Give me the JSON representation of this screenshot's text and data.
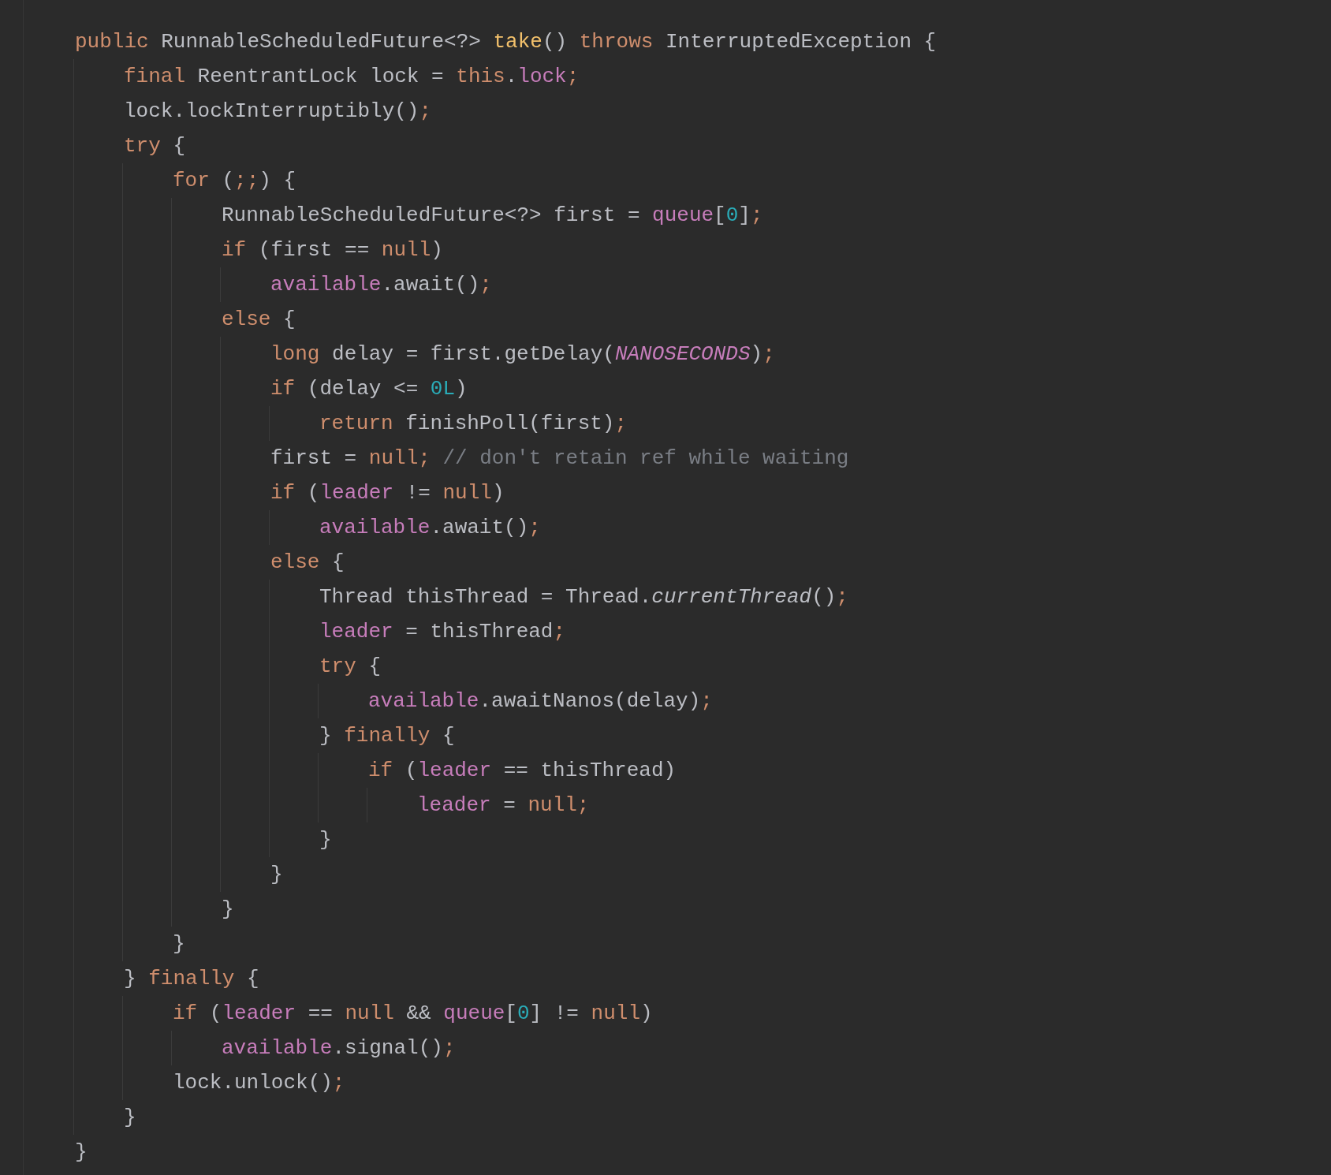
{
  "editor": {
    "lines": [
      {
        "tokens": [
          {
            "kind": "keyword",
            "text": "public"
          },
          {
            "kind": "plain",
            "text": " RunnableScheduledFuture<?> "
          },
          {
            "kind": "declaration",
            "text": "take"
          },
          {
            "kind": "plain",
            "text": "() "
          },
          {
            "kind": "keyword",
            "text": "throws"
          },
          {
            "kind": "plain",
            "text": " InterruptedException {"
          }
        ],
        "children": [
          {
            "tokens": [
              {
                "kind": "keyword",
                "text": "final"
              },
              {
                "kind": "plain",
                "text": " ReentrantLock lock = "
              },
              {
                "kind": "keyword",
                "text": "this"
              },
              {
                "kind": "plain",
                "text": "."
              },
              {
                "kind": "field",
                "text": "lock"
              },
              {
                "kind": "keyword",
                "text": ";"
              }
            ]
          },
          {
            "tokens": [
              {
                "kind": "plain",
                "text": "lock.lockInterruptibly()"
              },
              {
                "kind": "keyword",
                "text": ";"
              }
            ]
          },
          {
            "tokens": [
              {
                "kind": "keyword",
                "text": "try"
              },
              {
                "kind": "plain",
                "text": " {"
              }
            ],
            "children": [
              {
                "tokens": [
                  {
                    "kind": "keyword",
                    "text": "for"
                  },
                  {
                    "kind": "plain",
                    "text": " ("
                  },
                  {
                    "kind": "keyword",
                    "text": ";;"
                  },
                  {
                    "kind": "plain",
                    "text": ") {"
                  }
                ],
                "children": [
                  {
                    "tokens": [
                      {
                        "kind": "plain",
                        "text": "RunnableScheduledFuture<?> first = "
                      },
                      {
                        "kind": "field",
                        "text": "queue"
                      },
                      {
                        "kind": "plain",
                        "text": "["
                      },
                      {
                        "kind": "number",
                        "text": "0"
                      },
                      {
                        "kind": "plain",
                        "text": "]"
                      },
                      {
                        "kind": "keyword",
                        "text": ";"
                      }
                    ]
                  },
                  {
                    "tokens": [
                      {
                        "kind": "keyword",
                        "text": "if"
                      },
                      {
                        "kind": "plain",
                        "text": " (first == "
                      },
                      {
                        "kind": "keyword",
                        "text": "null"
                      },
                      {
                        "kind": "plain",
                        "text": ")"
                      }
                    ],
                    "children": [
                      {
                        "tokens": [
                          {
                            "kind": "field",
                            "text": "available"
                          },
                          {
                            "kind": "plain",
                            "text": ".await()"
                          },
                          {
                            "kind": "keyword",
                            "text": ";"
                          }
                        ]
                      }
                    ]
                  },
                  {
                    "tokens": [
                      {
                        "kind": "keyword",
                        "text": "else"
                      },
                      {
                        "kind": "plain",
                        "text": " {"
                      }
                    ],
                    "children": [
                      {
                        "tokens": [
                          {
                            "kind": "keyword",
                            "text": "long"
                          },
                          {
                            "kind": "plain",
                            "text": " delay = first.getDelay("
                          },
                          {
                            "kind": "static_field",
                            "text": "NANOSECONDS"
                          },
                          {
                            "kind": "plain",
                            "text": ")"
                          },
                          {
                            "kind": "keyword",
                            "text": ";"
                          }
                        ]
                      },
                      {
                        "tokens": [
                          {
                            "kind": "keyword",
                            "text": "if"
                          },
                          {
                            "kind": "plain",
                            "text": " (delay <= "
                          },
                          {
                            "kind": "number",
                            "text": "0L"
                          },
                          {
                            "kind": "plain",
                            "text": ")"
                          }
                        ],
                        "children": [
                          {
                            "tokens": [
                              {
                                "kind": "keyword",
                                "text": "return"
                              },
                              {
                                "kind": "plain",
                                "text": " finishPoll(first)"
                              },
                              {
                                "kind": "keyword",
                                "text": ";"
                              }
                            ]
                          }
                        ]
                      },
                      {
                        "tokens": [
                          {
                            "kind": "plain",
                            "text": "first = "
                          },
                          {
                            "kind": "keyword",
                            "text": "null;"
                          },
                          {
                            "kind": "comment",
                            "text": " // don't retain ref while waiting"
                          }
                        ]
                      },
                      {
                        "tokens": [
                          {
                            "kind": "keyword",
                            "text": "if"
                          },
                          {
                            "kind": "plain",
                            "text": " ("
                          },
                          {
                            "kind": "field",
                            "text": "leader"
                          },
                          {
                            "kind": "plain",
                            "text": " != "
                          },
                          {
                            "kind": "keyword",
                            "text": "null"
                          },
                          {
                            "kind": "plain",
                            "text": ")"
                          }
                        ],
                        "children": [
                          {
                            "tokens": [
                              {
                                "kind": "field",
                                "text": "available"
                              },
                              {
                                "kind": "plain",
                                "text": ".await()"
                              },
                              {
                                "kind": "keyword",
                                "text": ";"
                              }
                            ]
                          }
                        ]
                      },
                      {
                        "tokens": [
                          {
                            "kind": "keyword",
                            "text": "else"
                          },
                          {
                            "kind": "plain",
                            "text": " {"
                          }
                        ],
                        "children": [
                          {
                            "tokens": [
                              {
                                "kind": "plain",
                                "text": "Thread thisThread = Thread."
                              },
                              {
                                "kind": "static_call",
                                "text": "currentThread"
                              },
                              {
                                "kind": "plain",
                                "text": "()"
                              },
                              {
                                "kind": "keyword",
                                "text": ";"
                              }
                            ]
                          },
                          {
                            "tokens": [
                              {
                                "kind": "field",
                                "text": "leader"
                              },
                              {
                                "kind": "plain",
                                "text": " = thisThread"
                              },
                              {
                                "kind": "keyword",
                                "text": ";"
                              }
                            ]
                          },
                          {
                            "tokens": [
                              {
                                "kind": "keyword",
                                "text": "try"
                              },
                              {
                                "kind": "plain",
                                "text": " {"
                              }
                            ],
                            "children": [
                              {
                                "tokens": [
                                  {
                                    "kind": "field",
                                    "text": "available"
                                  },
                                  {
                                    "kind": "plain",
                                    "text": ".awaitNanos(delay)"
                                  },
                                  {
                                    "kind": "keyword",
                                    "text": ";"
                                  }
                                ]
                              }
                            ]
                          },
                          {
                            "tokens": [
                              {
                                "kind": "plain",
                                "text": "} "
                              },
                              {
                                "kind": "keyword",
                                "text": "finally"
                              },
                              {
                                "kind": "plain",
                                "text": " {"
                              }
                            ],
                            "children": [
                              {
                                "tokens": [
                                  {
                                    "kind": "keyword",
                                    "text": "if"
                                  },
                                  {
                                    "kind": "plain",
                                    "text": " ("
                                  },
                                  {
                                    "kind": "field",
                                    "text": "leader"
                                  },
                                  {
                                    "kind": "plain",
                                    "text": " == thisThread)"
                                  }
                                ],
                                "children": [
                                  {
                                    "tokens": [
                                      {
                                        "kind": "field",
                                        "text": "leader"
                                      },
                                      {
                                        "kind": "plain",
                                        "text": " = "
                                      },
                                      {
                                        "kind": "keyword",
                                        "text": "null;"
                                      }
                                    ]
                                  }
                                ]
                              }
                            ]
                          },
                          {
                            "tokens": [
                              {
                                "kind": "plain",
                                "text": "}"
                              }
                            ]
                          }
                        ]
                      },
                      {
                        "tokens": [
                          {
                            "kind": "plain",
                            "text": "}"
                          }
                        ]
                      }
                    ]
                  },
                  {
                    "tokens": [
                      {
                        "kind": "plain",
                        "text": "}"
                      }
                    ]
                  }
                ]
              },
              {
                "tokens": [
                  {
                    "kind": "plain",
                    "text": "}"
                  }
                ]
              }
            ]
          },
          {
            "tokens": [
              {
                "kind": "plain",
                "text": "} "
              },
              {
                "kind": "keyword",
                "text": "finally"
              },
              {
                "kind": "plain",
                "text": " {"
              }
            ],
            "children": [
              {
                "tokens": [
                  {
                    "kind": "keyword",
                    "text": "if"
                  },
                  {
                    "kind": "plain",
                    "text": " ("
                  },
                  {
                    "kind": "field",
                    "text": "leader"
                  },
                  {
                    "kind": "plain",
                    "text": " == "
                  },
                  {
                    "kind": "keyword",
                    "text": "null"
                  },
                  {
                    "kind": "plain",
                    "text": " && "
                  },
                  {
                    "kind": "field",
                    "text": "queue"
                  },
                  {
                    "kind": "plain",
                    "text": "["
                  },
                  {
                    "kind": "number",
                    "text": "0"
                  },
                  {
                    "kind": "plain",
                    "text": "] != "
                  },
                  {
                    "kind": "keyword",
                    "text": "null"
                  },
                  {
                    "kind": "plain",
                    "text": ")"
                  }
                ],
                "children": [
                  {
                    "tokens": [
                      {
                        "kind": "field",
                        "text": "available"
                      },
                      {
                        "kind": "plain",
                        "text": ".signal()"
                      },
                      {
                        "kind": "keyword",
                        "text": ";"
                      }
                    ]
                  }
                ]
              },
              {
                "tokens": [
                  {
                    "kind": "plain",
                    "text": "lock.unlock()"
                  },
                  {
                    "kind": "keyword",
                    "text": ";"
                  }
                ]
              }
            ]
          },
          {
            "tokens": [
              {
                "kind": "plain",
                "text": "}"
              }
            ]
          }
        ]
      },
      {
        "tokens": [
          {
            "kind": "plain",
            "text": "}"
          }
        ]
      }
    ]
  }
}
